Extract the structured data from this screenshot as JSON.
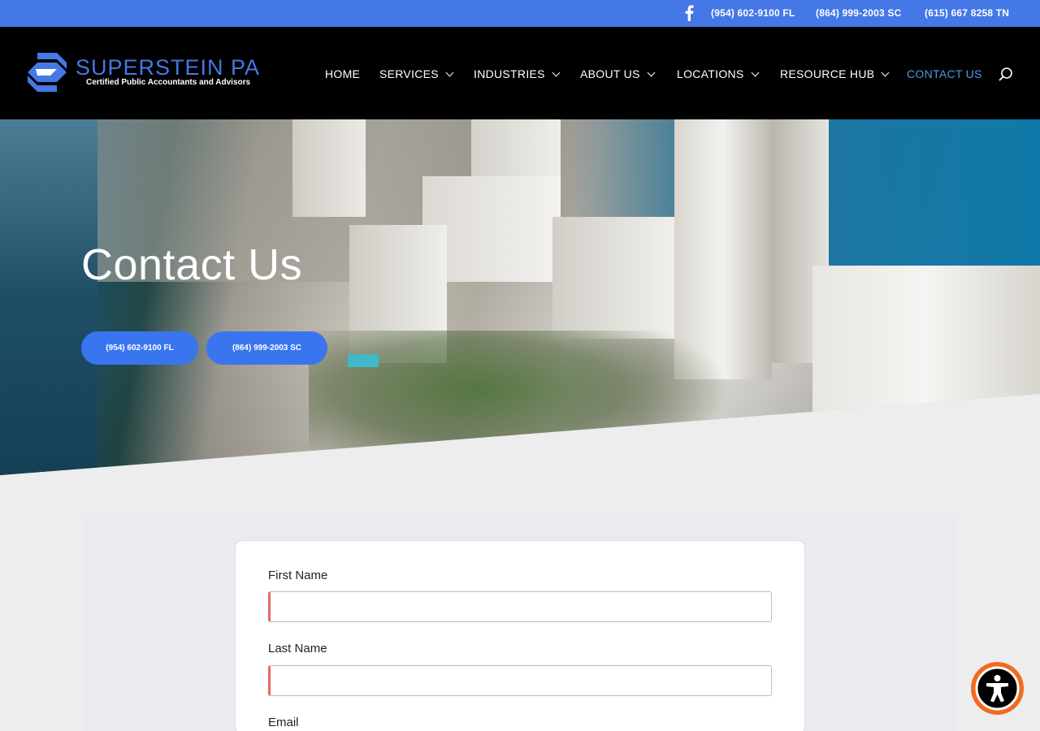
{
  "topbar": {
    "facebook_icon": "facebook-icon",
    "phones": [
      "(954) 602-9100 FL",
      "(864) 999-2003 SC",
      "(615) 667 8258 TN"
    ]
  },
  "header": {
    "logo_title": "SUPERSTEIN PA",
    "logo_tagline": "Certified Public Accountants and Advisors",
    "nav": [
      {
        "label": "HOME",
        "has_dropdown": false,
        "active": false
      },
      {
        "label": "SERVICES",
        "has_dropdown": true,
        "active": false
      },
      {
        "label": "INDUSTRIES",
        "has_dropdown": true,
        "active": false
      },
      {
        "label": "ABOUT US",
        "has_dropdown": true,
        "active": false
      },
      {
        "label": "LOCATIONS",
        "has_dropdown": true,
        "active": false
      },
      {
        "label": "RESOURCE HUB",
        "has_dropdown": true,
        "active": false
      },
      {
        "label": "CONTACT US",
        "has_dropdown": false,
        "active": true
      }
    ],
    "search_icon": "search-icon"
  },
  "hero": {
    "title": "Contact Us",
    "buttons": [
      "(954) 602-9100 FL",
      "(864) 999-2003 SC"
    ]
  },
  "form": {
    "fields": [
      {
        "label": "First Name",
        "value": ""
      },
      {
        "label": "Last Name",
        "value": ""
      },
      {
        "label": "Email"
      }
    ]
  },
  "accessibility": {
    "icon": "accessibility-icon"
  },
  "colors": {
    "topbar": "#4478e6",
    "header": "#000000",
    "accent": "#3a75f0",
    "nav_active": "#4a9be8",
    "required_marker": "#e06a6a",
    "a11y": "#f26a21"
  }
}
